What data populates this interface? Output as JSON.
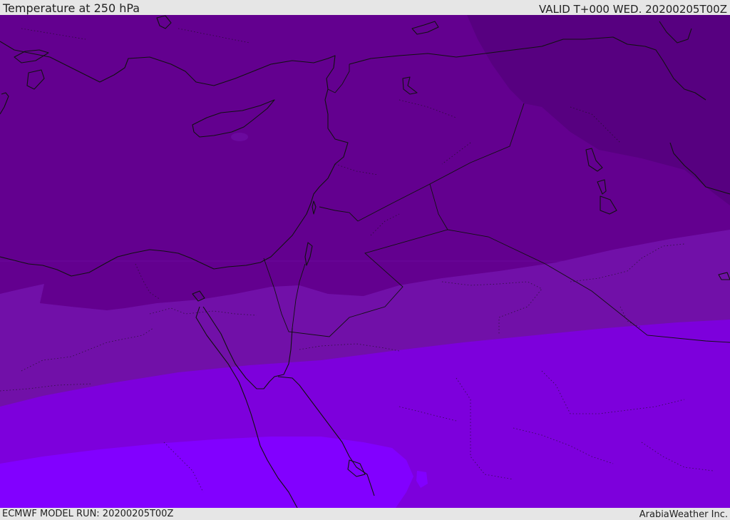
{
  "header": {
    "title": "Temperature at 250 hPa",
    "valid": "VALID T+000 WED. 20200205T00Z"
  },
  "footer": {
    "model_run": "ECMWF MODEL RUN: 20200205T00Z",
    "credit": "ArabiaWeather Inc."
  },
  "map": {
    "variable": "temperature",
    "level": "250 hPa",
    "region": "Eastern Mediterranean and Middle East",
    "fill_colors": {
      "coldest": "#570080",
      "cold": "#63008f",
      "mid": "#7110a8",
      "warm": "#7d00dc",
      "warmest": "#8200ff"
    },
    "line_color": "#111111"
  }
}
